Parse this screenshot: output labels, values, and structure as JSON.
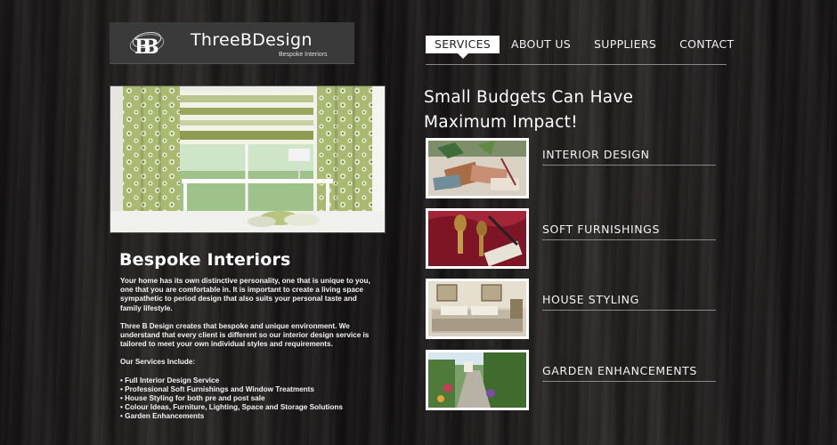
{
  "logo": {
    "title": "ThreeBDesign",
    "subtitle": "Bespoke Interiors",
    "mark_text": "B"
  },
  "nav": {
    "items": [
      {
        "label": "SERVICES",
        "active": true
      },
      {
        "label": "ABOUT US",
        "active": false
      },
      {
        "label": "SUPPLIERS",
        "active": false
      },
      {
        "label": "CONTACT",
        "active": false
      }
    ]
  },
  "main": {
    "title": "Bespoke Interiors",
    "paragraphs": [
      "Your home has its own distinctive personality, one that is unique to you, one that you are comfortable in. It is important to create a living space sympathetic to period design that also suits your personal taste and family lifestyle.",
      "Three B Design creates that bespoke and unique environment. We understand that every client is different so our interior design service is tailored to meet your own individual styles and requirements.",
      "Our Services Include:"
    ],
    "services_list": [
      "• Full Interior Design Service",
      "• Professional Soft Furnishings and Window Treatments",
      "• House Styling for both pre and post sale",
      "• Colour Ideas, Furniture, Lighting, Space and Storage Solutions",
      "• Garden Enhancements"
    ]
  },
  "aside": {
    "headline_line1": "Small Budgets Can Have",
    "headline_line2": "Maximum Impact!",
    "services": [
      {
        "label": "INTERIOR DESIGN"
      },
      {
        "label": "SOFT FURNISHINGS"
      },
      {
        "label": "HOUSE STYLING"
      },
      {
        "label": "GARDEN ENHANCEMENTS"
      }
    ]
  },
  "colors": {
    "background": "#1c1a1a",
    "logo_bg": "#3a3a3a",
    "text": "#ffffff",
    "rule": "#888888",
    "curtain_green": "#a8b86a"
  }
}
